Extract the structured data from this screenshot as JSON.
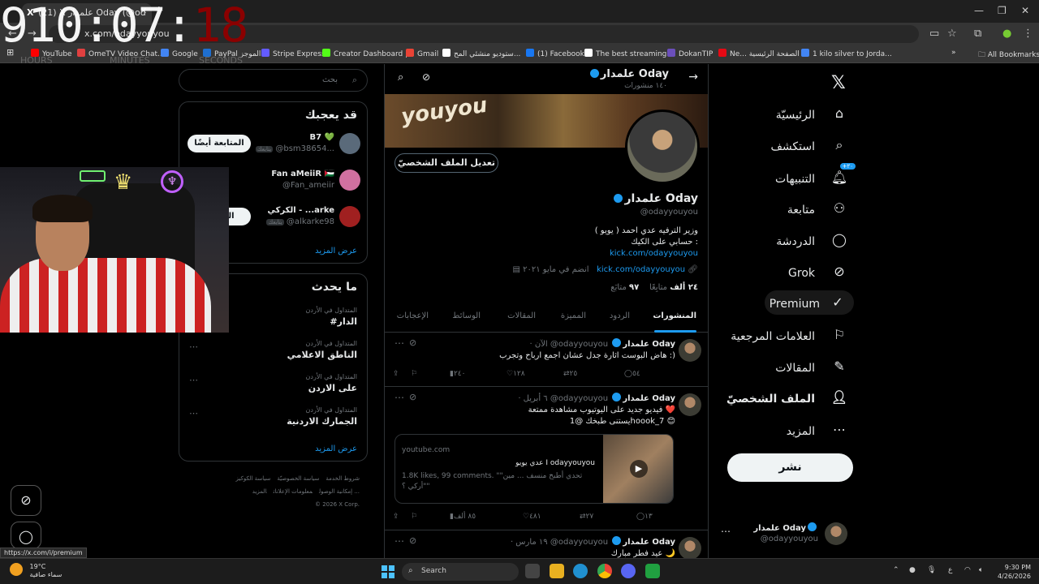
{
  "timer": {
    "hours": "910",
    "sep1": ":",
    "minutes": "07",
    "sep2": ":",
    "seconds": "18",
    "label_hours": "HOURS",
    "label_minutes": "MINUTES",
    "label_seconds": "SECONDS"
  },
  "browser": {
    "tab_title": "(21) X علمدار Oday (@od",
    "url": "x.com/odayyouyou",
    "bookmarks": [
      {
        "label": "YouTube",
        "color": "#ff0000"
      },
      {
        "label": "OmeTV Video Chat...",
        "color": "#e04040"
      },
      {
        "label": "Google",
        "color": "#4285f4"
      },
      {
        "label": "PayPal الموجز",
        "color": "#1f6fd0"
      },
      {
        "label": "Stripe Express",
        "color": "#635bff"
      },
      {
        "label": "Creator Dashboard |...",
        "color": "#53fc18"
      },
      {
        "label": "Gmail",
        "color": "#ea4335"
      },
      {
        "label": "ستوديو منشئي المح...",
        "color": "#ffffff"
      },
      {
        "label": "(1) Facebook",
        "color": "#1877f2"
      },
      {
        "label": "The best streaming...",
        "color": "#ffffff"
      },
      {
        "label": "DokanTIP",
        "color": "#6b4fbb"
      },
      {
        "label": "Ne... الصفحة الرئيسية",
        "color": "#e50914"
      },
      {
        "label": "1 kilo silver to Jorda...",
        "color": "#4285f4"
      }
    ],
    "all_bookmarks": "All Bookmarks"
  },
  "nav": {
    "items": [
      {
        "label": "الرئيسيّة",
        "icon": "home-icon",
        "glyph": "⌂"
      },
      {
        "label": "استكشف",
        "icon": "search-icon",
        "glyph": "⌕"
      },
      {
        "label": "التنبيهات",
        "icon": "bell-icon",
        "glyph": "🔔︎"
      },
      {
        "label": "متابعة",
        "icon": "add-user-icon",
        "glyph": "⚇"
      },
      {
        "label": "الدردشة",
        "icon": "chat-icon",
        "glyph": "◯"
      },
      {
        "label": "Grok",
        "icon": "grok-icon",
        "glyph": "⊘"
      },
      {
        "label": "Premium",
        "icon": "premium-icon",
        "glyph": "✓"
      },
      {
        "label": "العلامات المرجعية",
        "icon": "bookmark-icon",
        "glyph": "⚐"
      },
      {
        "label": "المقالات",
        "icon": "article-icon",
        "glyph": "✎"
      },
      {
        "label": "الملف الشخصيّ",
        "icon": "profile-icon",
        "glyph": "👤︎"
      },
      {
        "label": "المزيد",
        "icon": "more-icon",
        "glyph": "⋯"
      }
    ],
    "notifications_badge": "+٢٠",
    "post_button": "نشر",
    "account": {
      "name": "علمدار Oday",
      "handle": "@odayyouyou"
    }
  },
  "profile": {
    "header_name": "علمدار Oday",
    "header_posts": "١٤٠ منشورات",
    "banner_text": "youyou",
    "edit_button": "تعديل الملف الشخصيّ",
    "name": "علمدار Oday",
    "handle": "@odayyouyou",
    "bio_line1": "وزير الترفيه عدي احمد ( يويو )",
    "bio_line2": "حسابي على الكيك :",
    "bio_link": "kick.com/odayyouyou",
    "meta_link": "kick.com/odayyouyou",
    "joined": "انضم في مايو ٢٠٢١",
    "following_count": "٩٧",
    "following_label": "متابَع",
    "followers_count": "٢٤ ألف",
    "followers_label": "متابِعًا",
    "tabs": [
      "المنشورات",
      "الردود",
      "المميزة",
      "المقالات",
      "الوسائط",
      "الإعجابات"
    ]
  },
  "tweets": [
    {
      "name": "علمدار Oday",
      "handle": "@odayyouyou",
      "time": "· الآن",
      "text1": "هاض البوست اثارة جدل عشان اجمع ارباح وتجرب :)",
      "text2": "",
      "replies": "٥٤",
      "reposts": "٢٥",
      "likes": "١٢٨",
      "views": "٢٤٠"
    },
    {
      "name": "علمدار Oday",
      "handle": "@odayyouyou",
      "time": "· ٦ أبريل",
      "text1": "فيديو جديد على اليوتيوب مشاهدة ممتعة ❤️",
      "text2": "يستنى طبخك @1hoook_7 😊",
      "replies": "١٣",
      "reposts": "٢٧",
      "likes": "٤٨١",
      "views": "٨٥ ألف"
    },
    {
      "name": "علمدار Oday",
      "handle": "@odayyouyou",
      "time": "· ١٩ مارس",
      "text1": "عيد فطر مبارك 🌙",
      "text2": "",
      "replies": "",
      "reposts": "",
      "likes": "",
      "views": ""
    }
  ],
  "card": {
    "site": "youtube.com",
    "title": "عدي يويو I odayyouyou",
    "desc": "1.8K likes, 99 comments. \"تحدي أطبخ منسف ... مين\" \"أركي ؟\""
  },
  "sidebar": {
    "search_placeholder": "بحث",
    "who_title": "قد يعجبك",
    "who": [
      {
        "name": "B7 💚",
        "handle": "@bsm38654...",
        "follows": "يتابعك",
        "button": "المتابعة أيضًا",
        "color": "#5a6a7a"
      },
      {
        "name": "Fan aMeiiR 🇵🇸",
        "handle": "@Fan_ameiir",
        "follows": "",
        "button": "",
        "color": "#d070a0"
      },
      {
        "name": "الكركي - ...arke",
        "handle": "@alkarke98",
        "follows": "يتابعك",
        "button": "المتابعة",
        "color": "#a02020"
      }
    ],
    "show_more": "عرض المزيد",
    "trends_title": "ما يحدث",
    "trends": [
      {
        "cat": "المتداول في الأردن",
        "name": "#الدار"
      },
      {
        "cat": "المتداول في الأردن",
        "name": "الناطق الاعلامي"
      },
      {
        "cat": "المتداول في الأردن",
        "name": "على الاردن"
      },
      {
        "cat": "المتداول في الأردن",
        "name": "الجمارك الاردنية"
      }
    ],
    "trends_more": "عرض المزيد",
    "footer_row1": [
      "شروط الخدمة",
      "سياسة الخصوصيّة",
      "سياسة الكوكيز"
    ],
    "footer_row2": [
      "إمكانية الوصول",
      "معلومات الإعلانات",
      "المزيد ..."
    ],
    "footer_row3": "© 2026 X Corp."
  },
  "status_url": "https://x.com/i/premium",
  "taskbar": {
    "temp": "19°C",
    "weather": "سماء صافية",
    "search": "Search",
    "time": "9:30 PM",
    "date": "4/26/2026"
  }
}
